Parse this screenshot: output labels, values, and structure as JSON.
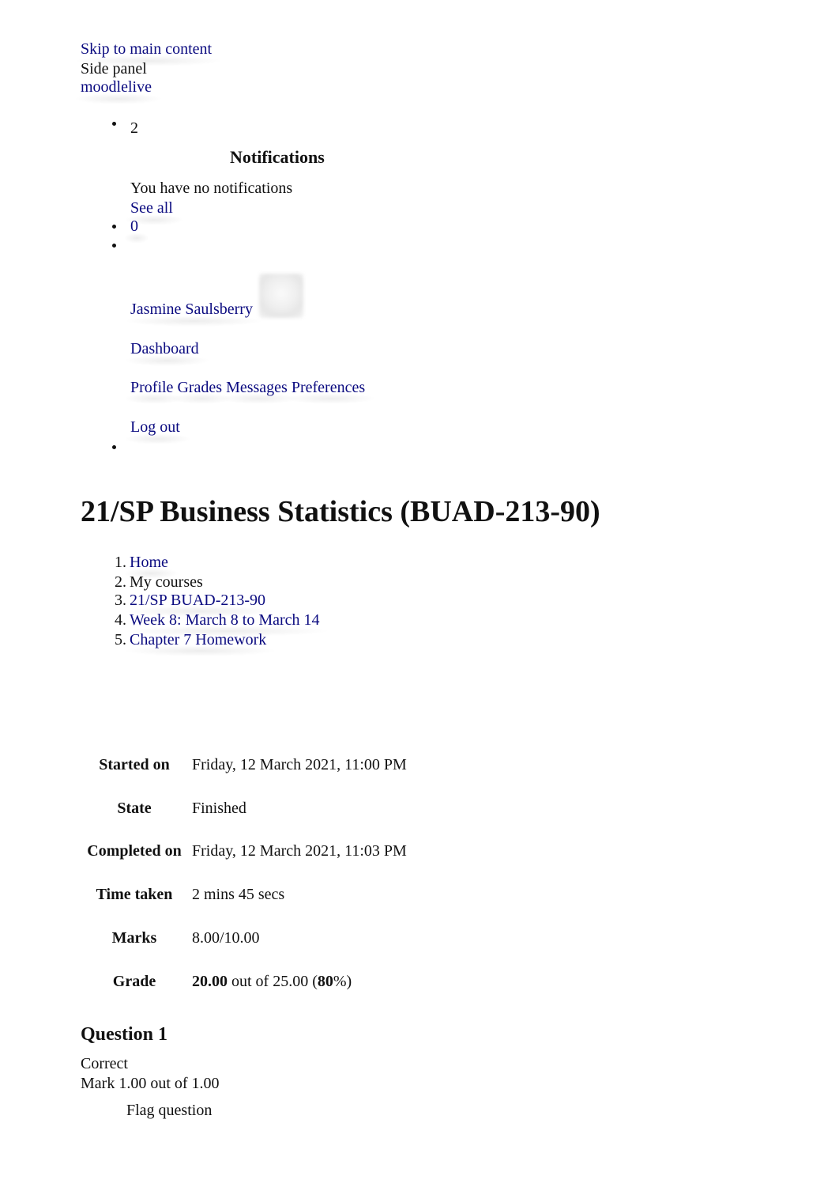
{
  "header": {
    "skip_link": "Skip to main content",
    "side_panel": "Side panel",
    "site_name": "moodlelive"
  },
  "nav": {
    "notification_count": "2",
    "notifications_heading": "Notifications",
    "notifications_empty": "You have no notifications",
    "see_all": "See all",
    "message_count": "0",
    "user": {
      "name": "Jasmine Saulsberry",
      "dashboard": "Dashboard",
      "menu_links": [
        "Profile",
        "Grades",
        "Messages",
        "Preferences"
      ],
      "logout": "Log out"
    }
  },
  "page": {
    "title": "21/SP Business Statistics (BUAD-213-90)",
    "breadcrumb": [
      {
        "num": "1.",
        "label": "Home",
        "link": true
      },
      {
        "num": "2.",
        "label": "My courses",
        "link": false
      },
      {
        "num": "3.",
        "label": "21/SP BUAD-213-90",
        "link": true
      },
      {
        "num": "4.",
        "label": "Week 8: March 8 to March 14",
        "link": true
      },
      {
        "num": "5.",
        "label": "Chapter 7 Homework",
        "link": true
      }
    ]
  },
  "summary": {
    "rows": [
      {
        "label": "Started on",
        "value": "Friday, 12 March 2021, 11:00 PM"
      },
      {
        "label": "State",
        "value": "Finished"
      },
      {
        "label": "Completed on",
        "value": "Friday, 12 March 2021, 11:03 PM"
      },
      {
        "label": "Time taken",
        "value": "2 mins 45 secs"
      },
      {
        "label": "Marks",
        "value": "8.00/10.00"
      }
    ],
    "grade": {
      "label": "Grade",
      "score": "20.00",
      "out_of_text": " out of 25.00 (",
      "percent": "80",
      "suffix": "%)"
    }
  },
  "question": {
    "heading": "Question 1",
    "status": "Correct",
    "mark": "Mark 1.00 out of 1.00",
    "flag": "Flag question"
  }
}
